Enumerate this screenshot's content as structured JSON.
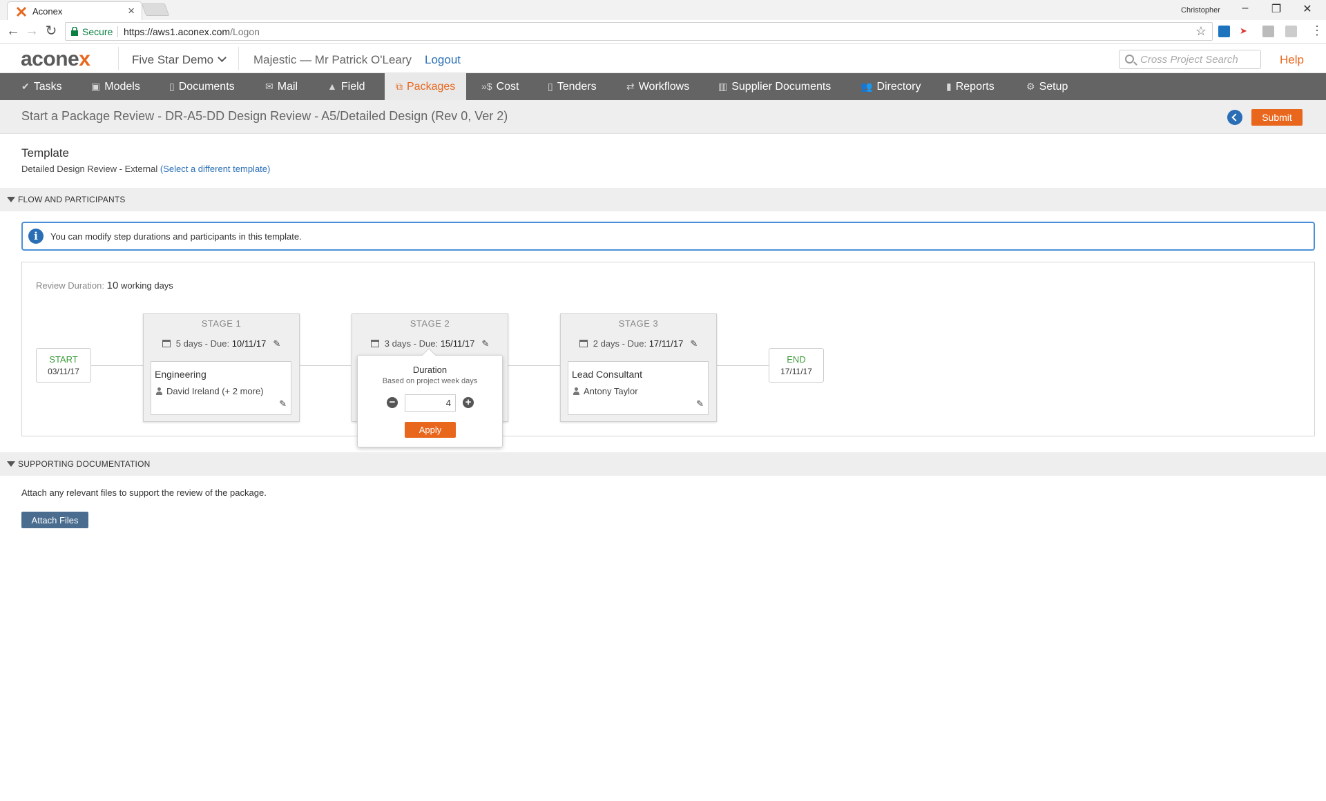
{
  "browser": {
    "tab_title": "Aconex",
    "profile_name": "Christopher",
    "secure_label": "Secure",
    "url_host": "https://aws1.aconex.com",
    "url_path": "/Logon"
  },
  "header": {
    "logo_main": "acone",
    "logo_x": "x",
    "project": "Five Star Demo",
    "org_user": "Majestic  —  Mr Patrick O'Leary",
    "logout": "Logout",
    "search_placeholder": "Cross Project Search",
    "help": "Help"
  },
  "nav": {
    "items": [
      {
        "label": "Tasks",
        "icon": "✔"
      },
      {
        "label": "Models",
        "icon": "▣"
      },
      {
        "label": "Documents",
        "icon": "▯"
      },
      {
        "label": "Mail",
        "icon": "✉"
      },
      {
        "label": "Field",
        "icon": "▲"
      },
      {
        "label": "Packages",
        "icon": "⧉"
      },
      {
        "label": "Cost",
        "icon": "»$"
      },
      {
        "label": "Tenders",
        "icon": "▯"
      },
      {
        "label": "Workflows",
        "icon": "⇄"
      },
      {
        "label": "Supplier Documents",
        "icon": "▥"
      },
      {
        "label": "Directory",
        "icon": "👥"
      },
      {
        "label": "Reports",
        "icon": "▮"
      },
      {
        "label": "Setup",
        "icon": "⚙"
      }
    ],
    "active": "Packages"
  },
  "page": {
    "title": "Start a Package Review - DR-A5-DD Design Review - A5/Detailed Design (Rev 0, Ver 2)",
    "submit": "Submit"
  },
  "template": {
    "heading": "Template",
    "name": "Detailed Design Review - External",
    "change_link": "(Select a different template)"
  },
  "flow": {
    "section_label": "FLOW AND PARTICIPANTS",
    "info": "You can modify step durations and participants in this template.",
    "review_duration_label": "Review Duration:",
    "review_duration_value": "10",
    "review_duration_unit": "working days",
    "start": {
      "label": "START",
      "date": "03/11/17"
    },
    "end": {
      "label": "END",
      "date": "17/11/17"
    },
    "stages": [
      {
        "title": "STAGE 1",
        "days": "5 days",
        "due_label": "- Due:",
        "due": "10/11/17",
        "role": "Engineering",
        "person": "David Ireland (+ 2 more)"
      },
      {
        "title": "STAGE 2",
        "days": "3 days",
        "due_label": "- Due:",
        "due": "15/11/17"
      },
      {
        "title": "STAGE 3",
        "days": "2 days",
        "due_label": "- Due:",
        "due": "17/11/17",
        "role": "Lead Consultant",
        "person": "Antony Taylor"
      }
    ],
    "popover": {
      "title": "Duration",
      "subtitle": "Based on project week days",
      "value": "4",
      "minus": "−",
      "plus": "+",
      "apply": "Apply"
    }
  },
  "support": {
    "section_label": "SUPPORTING DOCUMENTATION",
    "text": "Attach any relevant files to support the review of the package.",
    "attach": "Attach Files"
  }
}
